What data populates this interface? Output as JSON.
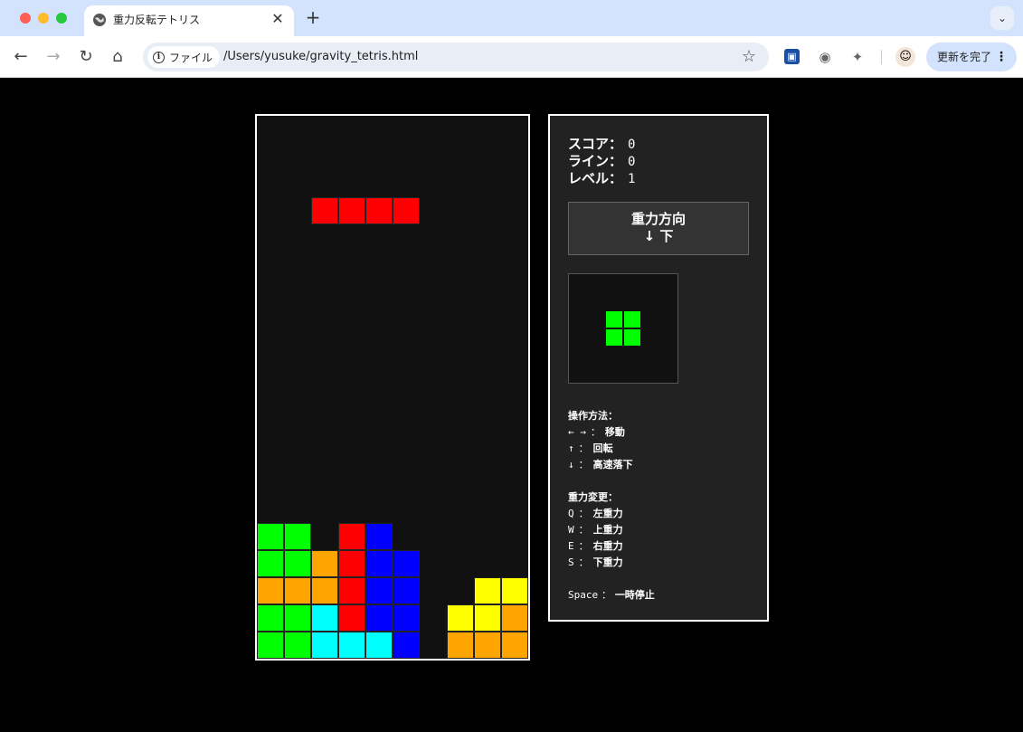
{
  "browser": {
    "tab_title": "重力反転テトリス",
    "new_tab_label": "+",
    "close_label": "✕",
    "tab_menu_label": "⌄",
    "site_chip_label": "ファイル",
    "url": "/Users/yusuke/gravity_tetris.html",
    "update_label": "更新を完了",
    "update_menu_label": "⋮"
  },
  "stats": {
    "score_label": "スコア：",
    "score_value": "0",
    "lines_label": "ライン：",
    "lines_value": "0",
    "level_label": "レベル：",
    "level_value": "1"
  },
  "gravity": {
    "title": "重力方向",
    "direction": "↓ 下"
  },
  "next_piece": {
    "type": "O",
    "color": "#00ff00"
  },
  "controls": {
    "heading": "操作方法：",
    "items": [
      {
        "key": "← →",
        "sep": "：",
        "action": "移動"
      },
      {
        "key": "↑",
        "sep": "：",
        "action": "回転"
      },
      {
        "key": "↓",
        "sep": "：",
        "action": "高速落下"
      }
    ]
  },
  "gravity_controls": {
    "heading": "重力変更：",
    "items": [
      {
        "key": "Q",
        "sep": "：",
        "action": "左重力"
      },
      {
        "key": "W",
        "sep": "：",
        "action": "上重力"
      },
      {
        "key": "E",
        "sep": "：",
        "action": "右重力"
      },
      {
        "key": "S",
        "sep": "：",
        "action": "下重力"
      }
    ]
  },
  "pause": {
    "key": "Space",
    "sep": "：",
    "action": "一時停止"
  },
  "board": {
    "cols": 10,
    "rows": 20,
    "colors": {
      "G": "#00ff00",
      "O": "#ffa500",
      "R": "#ff0000",
      "B": "#0000ff",
      "C": "#00ffff",
      "Y": "#ffff00"
    },
    "active_piece": {
      "color": "#ff0000",
      "cells": [
        [
          2,
          3
        ],
        [
          3,
          3
        ],
        [
          4,
          3
        ],
        [
          5,
          3
        ]
      ]
    },
    "grid": [
      "..........",
      "..........",
      "..........",
      "..........",
      "..........",
      "..........",
      "..........",
      "..........",
      "..........",
      "..........",
      "..........",
      "..........",
      "..........",
      "..........",
      "..........",
      "GG.RB.....",
      "GGORBB....",
      "OOORBB..YY",
      "GGCRBB.YYO",
      "GGCCCB.OOO"
    ]
  }
}
